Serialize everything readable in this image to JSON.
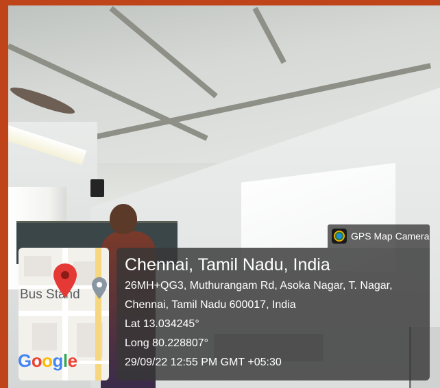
{
  "overlay": {
    "app_badge": "GPS Map Camera",
    "location_title": "Chennai, Tamil Nadu, India",
    "address_line_1": "26MH+QG3, Muthurangam Rd, Asoka Nagar, T. Nagar,",
    "address_line_2": "Chennai, Tamil Nadu 600017, India",
    "latitude": "Lat 13.034245°",
    "longitude": "Long 80.228807°",
    "timestamp": "29/09/22 12:55 PM GMT +05:30"
  },
  "map": {
    "place_label": "Bus Stand",
    "brand": "Google",
    "pin_color": "#e53935",
    "secondary_pin_color": "#8a97a3"
  },
  "colors": {
    "frame": "#c0441a",
    "card_background": "#373737"
  }
}
